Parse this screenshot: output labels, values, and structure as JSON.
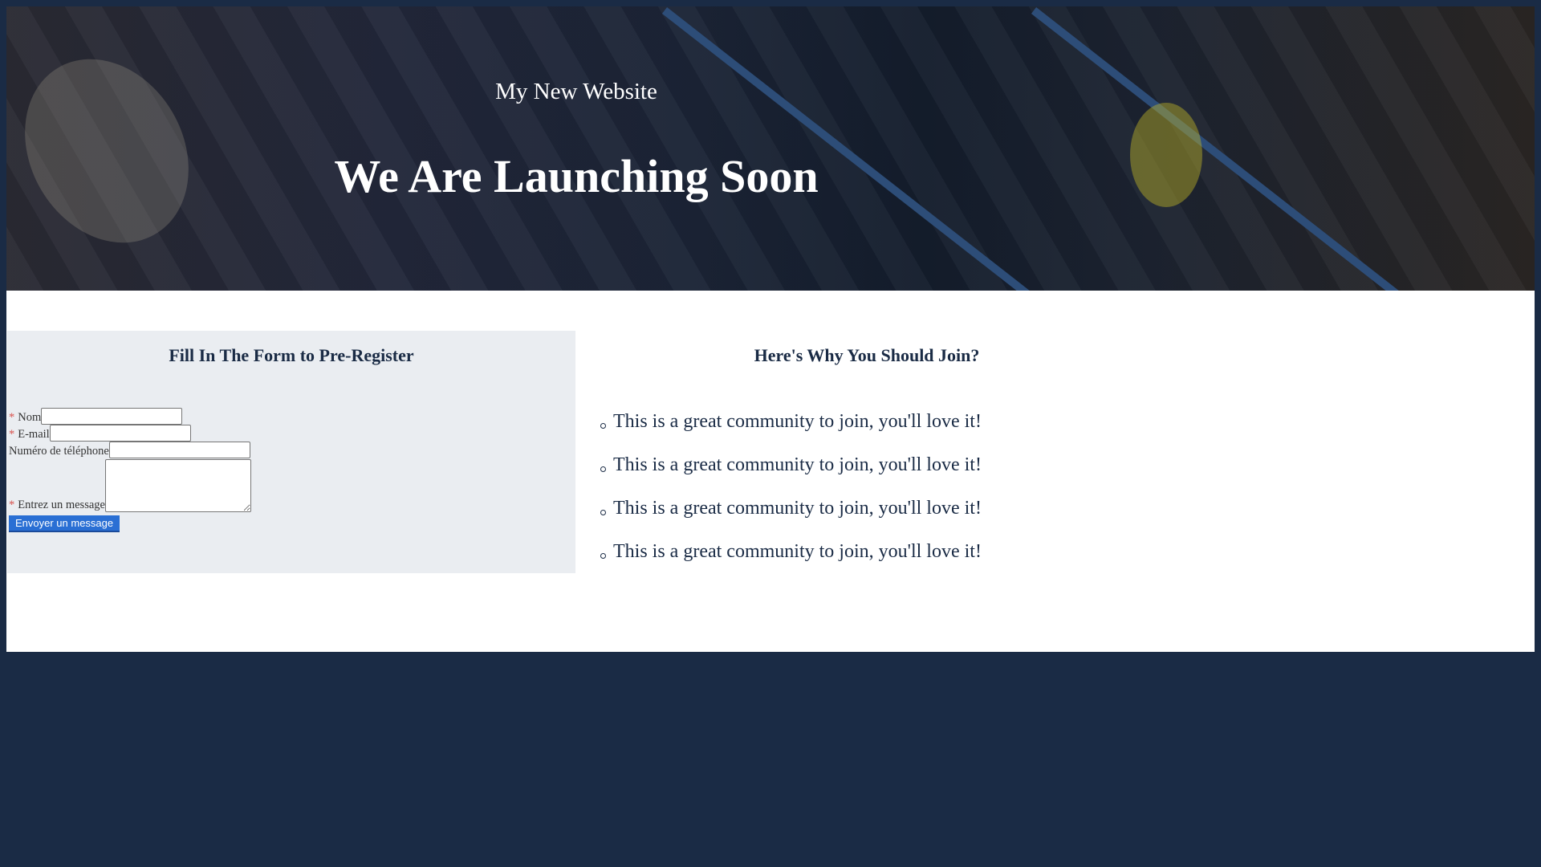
{
  "hero": {
    "site_name": "My New Website",
    "headline": "We Are Launching Soon"
  },
  "form": {
    "title": "Fill In The Form to Pre-Register",
    "required_mark": "*",
    "fields": {
      "name_label": "Nom",
      "email_label": "E-mail",
      "phone_label": "Numéro de téléphone",
      "message_label": "Entrez un message"
    },
    "submit_label": "Envoyer un message"
  },
  "why": {
    "title": "Here's Why You Should Join?",
    "items": [
      "This is a great community to join, you'll love it!",
      "This is a great community to join, you'll love it!",
      "This is a great community to join, you'll love it!",
      "This is a great community to join, you'll love it!"
    ]
  },
  "colors": {
    "navy": "#1a2b45",
    "panel": "#eaedf1",
    "button": "#2a6fd4",
    "required": "#d9534f"
  }
}
